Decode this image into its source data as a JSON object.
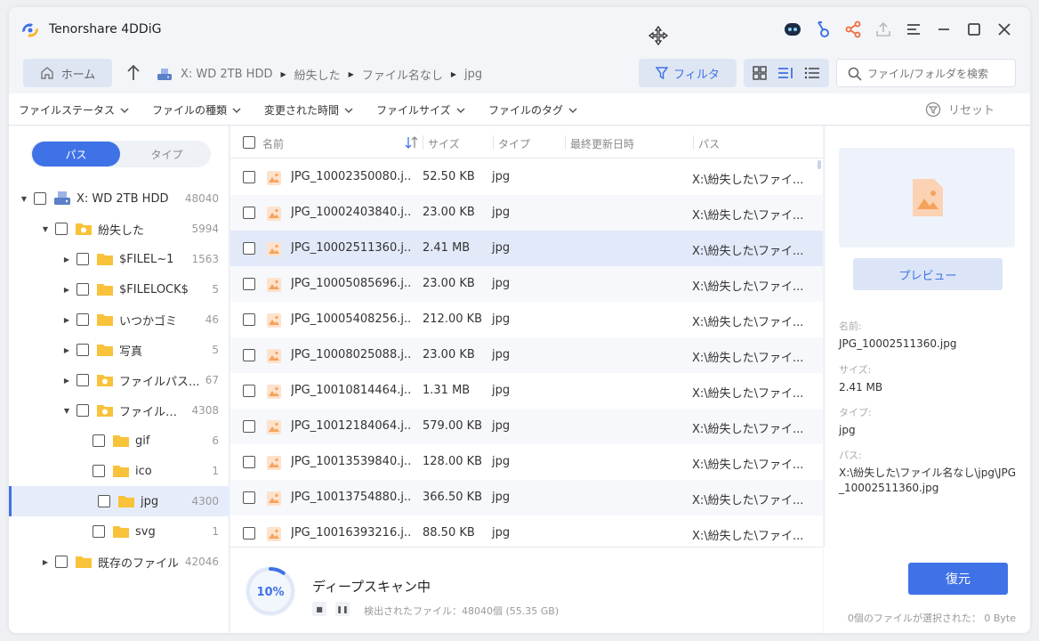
{
  "app": {
    "title": "Tenorshare 4DDiG"
  },
  "nav": {
    "home_label": "ホーム",
    "breadcrumbs": [
      "X: WD 2TB HDD",
      "紛失した",
      "ファイル名なし",
      "jpg"
    ],
    "filter_label": "フィルタ",
    "search_placeholder": "ファイル/フォルダを検索"
  },
  "filters": {
    "items": [
      "ファイルステータス",
      "ファイルの種類",
      "変更された時間",
      "ファイルサイズ",
      "ファイルのタグ"
    ],
    "reset_label": "リセット"
  },
  "sidebar": {
    "tabs": {
      "path": "パス",
      "type": "タイプ"
    },
    "tree": [
      {
        "name": "X: WD 2TB HDD",
        "count": "48040"
      },
      {
        "name": "紛失した",
        "count": "5994"
      },
      {
        "name": "$FILEL~1",
        "count": "1563"
      },
      {
        "name": "$FILELOCK$",
        "count": "5"
      },
      {
        "name": "いつかゴミ",
        "count": "46"
      },
      {
        "name": "写真",
        "count": "5"
      },
      {
        "name": "ファイルパス...",
        "count": "67"
      },
      {
        "name": "ファイル名...",
        "count": "4308"
      },
      {
        "name": "gif",
        "count": "6"
      },
      {
        "name": "ico",
        "count": "1"
      },
      {
        "name": "jpg",
        "count": "4300"
      },
      {
        "name": "svg",
        "count": "1"
      },
      {
        "name": "既存のファイル",
        "count": "42046"
      }
    ]
  },
  "table": {
    "headers": {
      "name": "名前",
      "size": "サイズ",
      "type": "タイプ",
      "modified": "最終更新日時",
      "path": "パス"
    },
    "rows": [
      {
        "name": "JPG_10002350080.j...",
        "size": "52.50 KB",
        "type": "jpg",
        "path": "X:\\紛失した\\ファイ..."
      },
      {
        "name": "JPG_10002403840.j...",
        "size": "23.00 KB",
        "type": "jpg",
        "path": "X:\\紛失した\\ファイ..."
      },
      {
        "name": "JPG_10002511360.j...",
        "size": "2.41 MB",
        "type": "jpg",
        "path": "X:\\紛失した\\ファイ..."
      },
      {
        "name": "JPG_10005085696.j...",
        "size": "23.00 KB",
        "type": "jpg",
        "path": "X:\\紛失した\\ファイ..."
      },
      {
        "name": "JPG_10005408256.j...",
        "size": "212.00 KB",
        "type": "jpg",
        "path": "X:\\紛失した\\ファイ..."
      },
      {
        "name": "JPG_10008025088.j...",
        "size": "23.00 KB",
        "type": "jpg",
        "path": "X:\\紛失した\\ファイ..."
      },
      {
        "name": "JPG_10010814464.j...",
        "size": "1.31 MB",
        "type": "jpg",
        "path": "X:\\紛失した\\ファイ..."
      },
      {
        "name": "JPG_10012184064.j...",
        "size": "579.00 KB",
        "type": "jpg",
        "path": "X:\\紛失した\\ファイ..."
      },
      {
        "name": "JPG_10013539840.j...",
        "size": "128.00 KB",
        "type": "jpg",
        "path": "X:\\紛失した\\ファイ..."
      },
      {
        "name": "JPG_10013754880.j...",
        "size": "366.50 KB",
        "type": "jpg",
        "path": "X:\\紛失した\\ファイ..."
      },
      {
        "name": "JPG_10016393216.j...",
        "size": "88.50 KB",
        "type": "jpg",
        "path": "X:\\紛失した\\ファイ..."
      }
    ]
  },
  "details": {
    "preview_label": "プレビュー",
    "name_label": "名前:",
    "name_value": "JPG_10002511360.jpg",
    "size_label": "サイズ:",
    "size_value": "2.41 MB",
    "type_label": "タイプ:",
    "type_value": "jpg",
    "path_label": "パス:",
    "path_value": "X:\\紛失した\\ファイル名なし\\jpg\\JPG_10002511360.jpg"
  },
  "scan": {
    "progress_text": "10%",
    "progress_fraction": 0.1,
    "status": "ディープスキャン中",
    "found": "検出されたファイル：48040個 (55.35 GB)"
  },
  "footer": {
    "recover_label": "復元",
    "selected_info": "0個のファイルが選択された： 0 Byte"
  },
  "colors": {
    "accent": "#3f72e6",
    "folder": "#f8c23a",
    "image_icon": "#f5a35c"
  }
}
